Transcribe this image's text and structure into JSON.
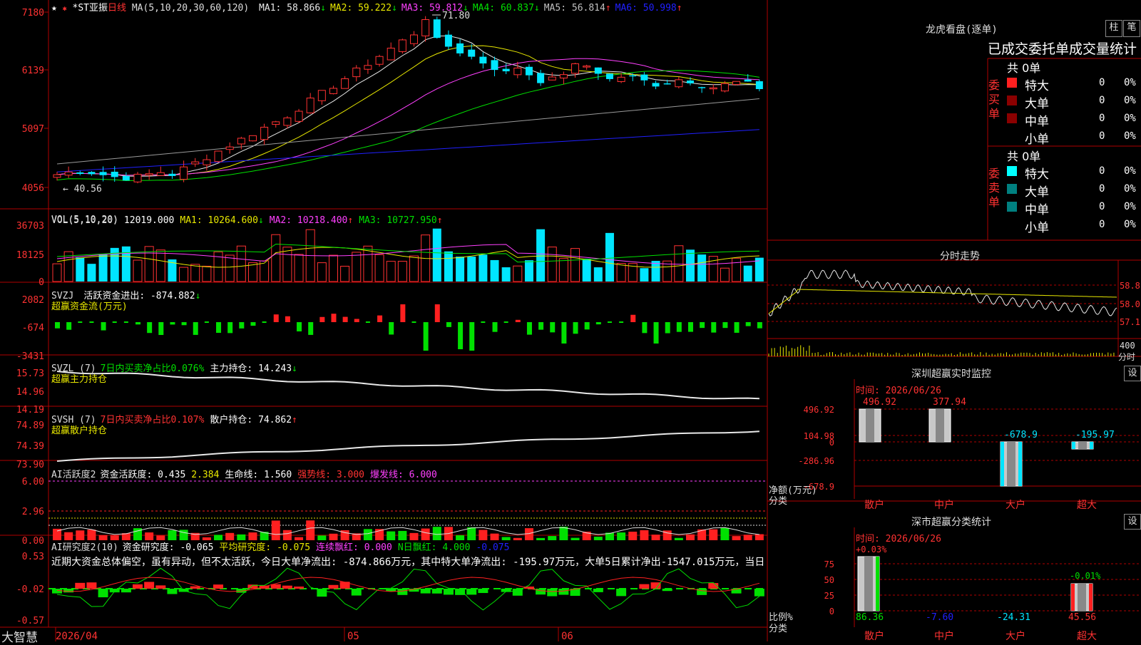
{
  "app": {
    "name": "大智慧",
    "stock_name": "*ST亚振",
    "period": "日线",
    "star_icons": [
      "star-filled-icon",
      "star-outline-icon"
    ]
  },
  "colors": {
    "up": "#ff3232",
    "down": "#00e5ff",
    "green": "#00e000",
    "yellow": "#e8e800",
    "magenta": "#ff40ff",
    "white": "#e8e8e8",
    "blue": "#2020ff",
    "gray": "#9a9a9a",
    "grid": "#b00000",
    "teal": "#008080",
    "darkred": "#8b0000"
  },
  "main": {
    "head_prefix": "MA(5,10,20,30,60,120)",
    "ma": [
      {
        "label": "MA1: 58.866",
        "arrow": "↓",
        "color": "#e8e8e8"
      },
      {
        "label": "MA2: 59.222",
        "arrow": "↓",
        "color": "#e8e800"
      },
      {
        "label": "MA3: 59.812",
        "arrow": "↓",
        "color": "#ff40ff"
      },
      {
        "label": "MA4: 60.837",
        "arrow": "↓",
        "color": "#00e000"
      },
      {
        "label": "MA5: 56.814",
        "arrow": "↑",
        "color": "#c0c0c0"
      },
      {
        "label": "MA6: 50.998",
        "arrow": "↑",
        "color": "#2020ff"
      }
    ],
    "y_ticks": [
      "7180",
      "6139",
      "5097",
      "4056"
    ],
    "high_label": "71.80",
    "low_label": "40.56"
  },
  "vol": {
    "head": "VOL(5,10,20)",
    "value": "12019.000",
    "ma": [
      {
        "label": "MA1: 10264.600",
        "arrow": "↓",
        "color": "#e8e800"
      },
      {
        "label": "MA2: 10218.400",
        "arrow": "↑",
        "color": "#ff40ff"
      },
      {
        "label": "MA3: 10727.950",
        "arrow": "↑",
        "color": "#00e000"
      }
    ],
    "y_ticks": [
      "36703",
      "18125",
      "0"
    ]
  },
  "svzj": {
    "head": "SVZJ",
    "label": "活跃资金进出: -874.882",
    "arrow": "↓",
    "sub": "超赢资金流(万元)",
    "y_ticks": [
      "2082",
      "-674",
      "-3431"
    ]
  },
  "svzl": {
    "head": "SVZL (7)",
    "label1": "7日内买卖净占比0.076%",
    "label2": "主力持仓: 14.243",
    "arrow": "↓",
    "sub": "超赢主力持仓",
    "y_ticks": [
      "15.73",
      "14.96",
      "14.19"
    ]
  },
  "svsh": {
    "head": "SVSH (7)",
    "label1": "7日内买卖净占比0.107%",
    "label2": "散户持仓: 74.862",
    "arrow": "↑",
    "sub": "超赢散户持仓",
    "y_ticks": [
      "74.89",
      "74.39",
      "73.90"
    ]
  },
  "ai1": {
    "head": "AI活跃度2",
    "label1": "资金活跃度: 0.435",
    "label2": "2.384",
    "label3": "生命线: 1.560",
    "label4": "强势线: 3.000",
    "label5": "爆发线: 6.000",
    "y_ticks": [
      "6.00",
      "2.96",
      "0.00"
    ]
  },
  "ai2": {
    "head": "AI研究度2(10)",
    "label1": "资金研究度: -0.065",
    "label2": "平均研究度: -0.075",
    "label3": "连续飘红: 0.000",
    "label4": "N日飘红: 4.000",
    "label5": "-0.075",
    "comment": "近期大资金总体偏空，虽有异动，但不太活跃，今日大单净流出: -874.866万元，其中特大单净流出: -195.97万元，大单5日累计净出-1547.015万元，当日",
    "y_ticks": [
      "0.53",
      "-0.02",
      "-0.57"
    ]
  },
  "x_axis": {
    "labels": [
      "2026/04",
      "05",
      "06"
    ]
  },
  "bottom": {
    "logo": "大智慧"
  },
  "longhu": {
    "title": "龙虎看盘(逐单)",
    "btn1": "柱",
    "btn2": "笔",
    "sub_title": "已成交委托单成交量统计",
    "buy": {
      "side_label": [
        "委",
        "买",
        "单"
      ],
      "total": "共 0单",
      "rows": [
        {
          "name": "特大",
          "count": "0",
          "pct": "0%",
          "color": "#ff2020"
        },
        {
          "name": "大单",
          "count": "0",
          "pct": "0%",
          "color": "#8b0000"
        },
        {
          "name": "中单",
          "count": "0",
          "pct": "0%",
          "color": "#8b0000"
        },
        {
          "name": "小单",
          "count": "0",
          "pct": "0%",
          "color": ""
        }
      ]
    },
    "sell": {
      "side_label": [
        "委",
        "卖",
        "单"
      ],
      "total": "共 0单",
      "rows": [
        {
          "name": "特大",
          "count": "0",
          "pct": "0%",
          "color": "#00ffff"
        },
        {
          "name": "大单",
          "count": "0",
          "pct": "0%",
          "color": "#008080"
        },
        {
          "name": "中单",
          "count": "0",
          "pct": "0%",
          "color": "#008080"
        },
        {
          "name": "小单",
          "count": "0",
          "pct": "0%",
          "color": ""
        }
      ]
    }
  },
  "fenshi": {
    "title": "分时走势",
    "y_ticks": [
      "58.8",
      "58.0",
      "57.1"
    ],
    "vol_tick": "400",
    "x_unit": "分时"
  },
  "monitor": {
    "title": "深圳超赢实时监控",
    "btn": "设",
    "time": "时间: 2026/06/26",
    "y_ticks": [
      "496.92",
      "104.98",
      "0",
      "-286.96",
      "-678.9"
    ],
    "y_title1": "净额(万元)",
    "y_title2": "分类",
    "bars": [
      {
        "cat": "散户",
        "value": 496.92,
        "label": "496.92"
      },
      {
        "cat": "中户",
        "value": 377.94,
        "label": "377.94"
      },
      {
        "cat": "大户",
        "value": -678.9,
        "label": "-678.9"
      },
      {
        "cat": "超大",
        "value": -195.97,
        "label": "-195.97"
      }
    ]
  },
  "classify": {
    "title": "深市超赢分类统计",
    "btn": "设",
    "time": "时间: 2026/06/26",
    "y_ticks": [
      "75",
      "50",
      "25",
      "0"
    ],
    "y_title1": "比例%",
    "y_title2": "分类",
    "top_labels": [
      "+0.03%",
      "-0.01%"
    ],
    "bars": [
      {
        "cat": "散户",
        "value": 86.36,
        "label": "86.36"
      },
      {
        "cat": "中户",
        "value": -7.6,
        "label": "-7.60"
      },
      {
        "cat": "大户",
        "value": -24.31,
        "label": "-24.31"
      },
      {
        "cat": "超大",
        "value": 45.56,
        "label": "45.56"
      }
    ]
  }
}
